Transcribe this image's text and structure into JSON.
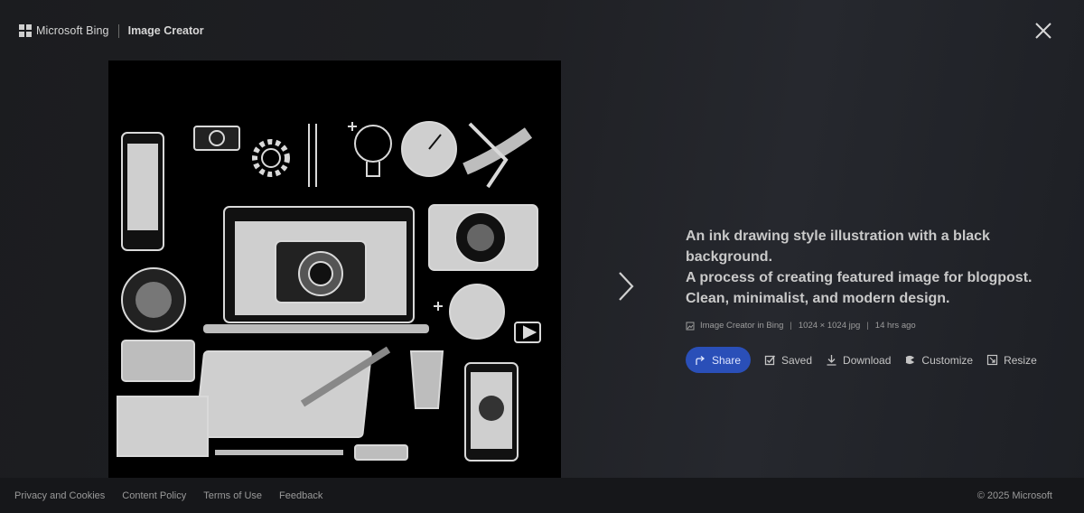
{
  "header": {
    "brand": "Microsoft Bing",
    "product": "Image Creator"
  },
  "icons": {
    "logo": "microsoft-logo-icon",
    "close": "close-icon",
    "next": "chevron-right-icon",
    "share": "share-icon",
    "saved": "saved-icon",
    "download": "download-icon",
    "customize": "customize-icon",
    "resize": "resize-icon"
  },
  "details": {
    "title_lines": [
      "An ink drawing style illustration with a black background.",
      "A process of creating featured image for blogpost.",
      "Clean, minimalist, and modern design."
    ],
    "meta": {
      "source": "Image Creator in Bing",
      "dimensions": "1024 × 1024 jpg",
      "age": "14 hrs ago"
    }
  },
  "actions": {
    "share": "Share",
    "saved": "Saved",
    "download": "Download",
    "customize": "Customize",
    "resize": "Resize"
  },
  "colors": {
    "share_bg": "#2a4fb8",
    "background": "#1f2024",
    "footer_bg": "#16171a"
  },
  "footer": {
    "links": [
      "Privacy and Cookies",
      "Content Policy",
      "Terms of Use",
      "Feedback"
    ],
    "copyright": "© 2025 Microsoft"
  }
}
